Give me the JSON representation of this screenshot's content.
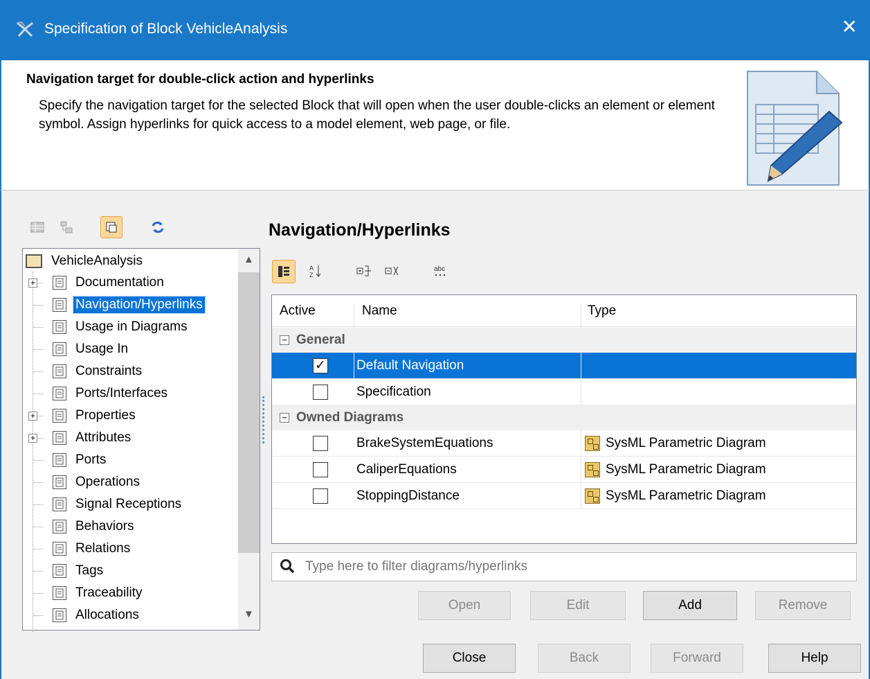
{
  "window": {
    "title": "Specification of Block VehicleAnalysis",
    "close_glyph": "✕"
  },
  "header": {
    "title": "Navigation target for double-click action and hyperlinks",
    "description": "Specify the navigation target for the selected Block that will open when the user double-clicks an element or element symbol. Assign hyperlinks for quick access to a model element, web page, or file.",
    "icon": "document-pencil-icon"
  },
  "toolbar_left": [
    {
      "name": "categorized-view-icon",
      "active": false
    },
    {
      "name": "tree-view-icon",
      "active": false
    },
    {
      "name": "show-all-icon",
      "active": true
    },
    {
      "name": "refresh-icon",
      "active": false
    }
  ],
  "tree": {
    "root": "VehicleAnalysis",
    "items": [
      {
        "label": "Documentation",
        "expandable": true,
        "selected": false
      },
      {
        "label": "Navigation/Hyperlinks",
        "expandable": false,
        "selected": true
      },
      {
        "label": "Usage in Diagrams",
        "expandable": false,
        "selected": false
      },
      {
        "label": "Usage In",
        "expandable": false,
        "selected": false
      },
      {
        "label": "Constraints",
        "expandable": false,
        "selected": false
      },
      {
        "label": "Ports/Interfaces",
        "expandable": false,
        "selected": false
      },
      {
        "label": "Properties",
        "expandable": true,
        "selected": false
      },
      {
        "label": "Attributes",
        "expandable": true,
        "selected": false
      },
      {
        "label": "Ports",
        "expandable": false,
        "selected": false
      },
      {
        "label": "Operations",
        "expandable": false,
        "selected": false
      },
      {
        "label": "Signal Receptions",
        "expandable": false,
        "selected": false
      },
      {
        "label": "Behaviors",
        "expandable": false,
        "selected": false
      },
      {
        "label": "Relations",
        "expandable": false,
        "selected": false
      },
      {
        "label": "Tags",
        "expandable": false,
        "selected": false
      },
      {
        "label": "Traceability",
        "expandable": false,
        "selected": false
      },
      {
        "label": "Allocations",
        "expandable": false,
        "selected": false
      }
    ]
  },
  "section_title": "Navigation/Hyperlinks",
  "grid_toolbar": [
    {
      "name": "group-by-category-icon",
      "active": true
    },
    {
      "name": "sort-alphabetically-icon",
      "active": false
    },
    {
      "name": "expand-all-icon",
      "active": false
    },
    {
      "name": "collapse-all-icon",
      "active": false
    },
    {
      "name": "show-text-icon",
      "active": false
    }
  ],
  "grid": {
    "columns": [
      "Active",
      "Name",
      "Type"
    ],
    "groups": [
      {
        "label": "General",
        "rows": [
          {
            "active": true,
            "name": "Default Navigation",
            "type": "",
            "selected": true
          },
          {
            "active": false,
            "name": "Specification",
            "type": "",
            "selected": false
          }
        ]
      },
      {
        "label": "Owned Diagrams",
        "rows": [
          {
            "active": false,
            "name": "BrakeSystemEquations",
            "type": "SysML Parametric Diagram",
            "selected": false
          },
          {
            "active": false,
            "name": "CaliperEquations",
            "type": "SysML Parametric Diagram",
            "selected": false
          },
          {
            "active": false,
            "name": "StoppingDistance",
            "type": "SysML Parametric Diagram",
            "selected": false
          }
        ]
      }
    ]
  },
  "search": {
    "placeholder": "Type here to filter diagrams/hyperlinks",
    "value": ""
  },
  "action_buttons": [
    {
      "label": "Open",
      "enabled": false
    },
    {
      "label": "Edit",
      "enabled": false
    },
    {
      "label": "Add",
      "enabled": true
    },
    {
      "label": "Remove",
      "enabled": false
    }
  ],
  "footer_buttons": [
    {
      "label": "Close",
      "enabled": true
    },
    {
      "label": "Back",
      "enabled": false
    },
    {
      "label": "Forward",
      "enabled": false
    },
    {
      "label": "Help",
      "enabled": true
    }
  ],
  "colors": {
    "titlebar": "#1a78c8",
    "selection": "#0a73d6"
  }
}
